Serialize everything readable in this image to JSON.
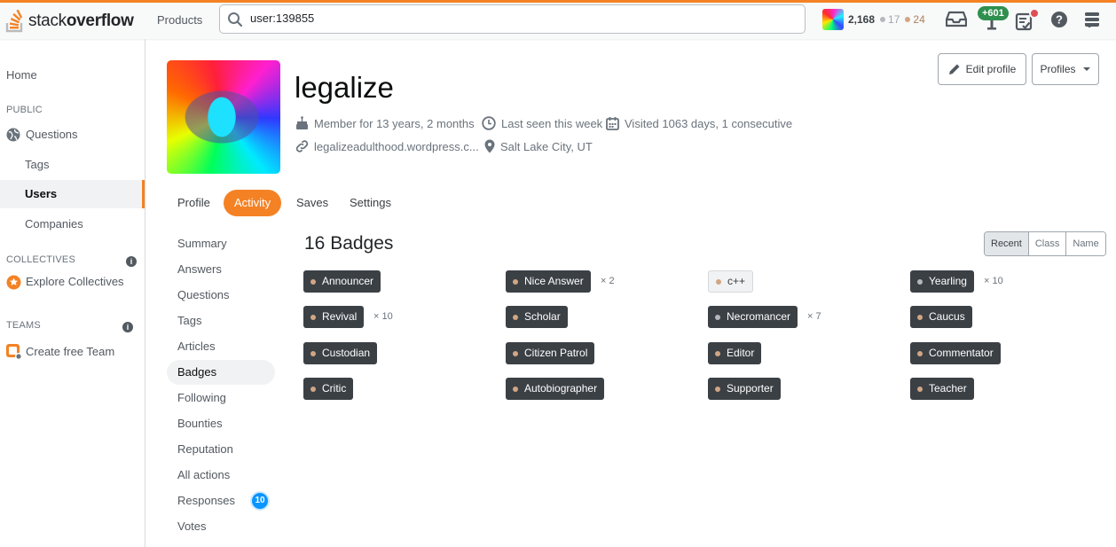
{
  "topbar": {
    "logo_light": "stack",
    "logo_bold": "overflow",
    "products_label": "Products",
    "search_value": "user:139855",
    "reputation": "2,168",
    "silver_count": "17",
    "bronze_count": "24",
    "achievements_delta": "+601",
    "colors": {
      "accent": "#f48225",
      "silver": "#b4b8bc",
      "bronze": "#d1a684",
      "green": "#2f8f4e"
    }
  },
  "leftnav": {
    "home": "Home",
    "public_header": "PUBLIC",
    "questions": "Questions",
    "tags": "Tags",
    "users": "Users",
    "companies": "Companies",
    "collectives_header": "COLLECTIVES",
    "explore_collectives": "Explore Collectives",
    "teams_header": "TEAMS",
    "create_team": "Create free Team",
    "info_glyph": "i"
  },
  "profile": {
    "name": "legalize",
    "member_for": "Member for 13 years, 2 months",
    "last_seen": "Last seen this week",
    "visited": "Visited 1063 days, 1 consecutive",
    "website": "legalizeadulthood.wordpress.c...",
    "location": "Salt Lake City, UT",
    "edit_profile": "Edit profile",
    "profiles": "Profiles"
  },
  "tabs": [
    "Profile",
    "Activity",
    "Saves",
    "Settings"
  ],
  "subnav": {
    "summary": "Summary",
    "answers": "Answers",
    "questions": "Questions",
    "tags": "Tags",
    "articles": "Articles",
    "badges": "Badges",
    "following": "Following",
    "bounties": "Bounties",
    "reputation": "Reputation",
    "all_actions": "All actions",
    "responses": "Responses",
    "responses_count": "10",
    "votes": "Votes"
  },
  "badges": {
    "title": "16 Badges",
    "sort": [
      "Recent",
      "Class",
      "Name"
    ],
    "items": [
      {
        "name": "Announcer",
        "class": "bronze",
        "count": ""
      },
      {
        "name": "Nice Answer",
        "class": "bronze",
        "count": "× 2"
      },
      {
        "name": "c++",
        "class": "bronze",
        "count": ""
      },
      {
        "name": "Yearling",
        "class": "silver",
        "count": "× 10"
      },
      {
        "name": "Revival",
        "class": "bronze",
        "count": "× 10"
      },
      {
        "name": "Scholar",
        "class": "bronze",
        "count": ""
      },
      {
        "name": "Necromancer",
        "class": "silver",
        "count": "× 7"
      },
      {
        "name": "Caucus",
        "class": "bronze",
        "count": ""
      },
      {
        "name": "Custodian",
        "class": "bronze",
        "count": ""
      },
      {
        "name": "Citizen Patrol",
        "class": "bronze",
        "count": ""
      },
      {
        "name": "Editor",
        "class": "bronze",
        "count": ""
      },
      {
        "name": "Commentator",
        "class": "bronze",
        "count": ""
      },
      {
        "name": "Critic",
        "class": "bronze",
        "count": ""
      },
      {
        "name": "Autobiographer",
        "class": "bronze",
        "count": ""
      },
      {
        "name": "Supporter",
        "class": "bronze",
        "count": ""
      },
      {
        "name": "Teacher",
        "class": "bronze",
        "count": ""
      }
    ]
  }
}
